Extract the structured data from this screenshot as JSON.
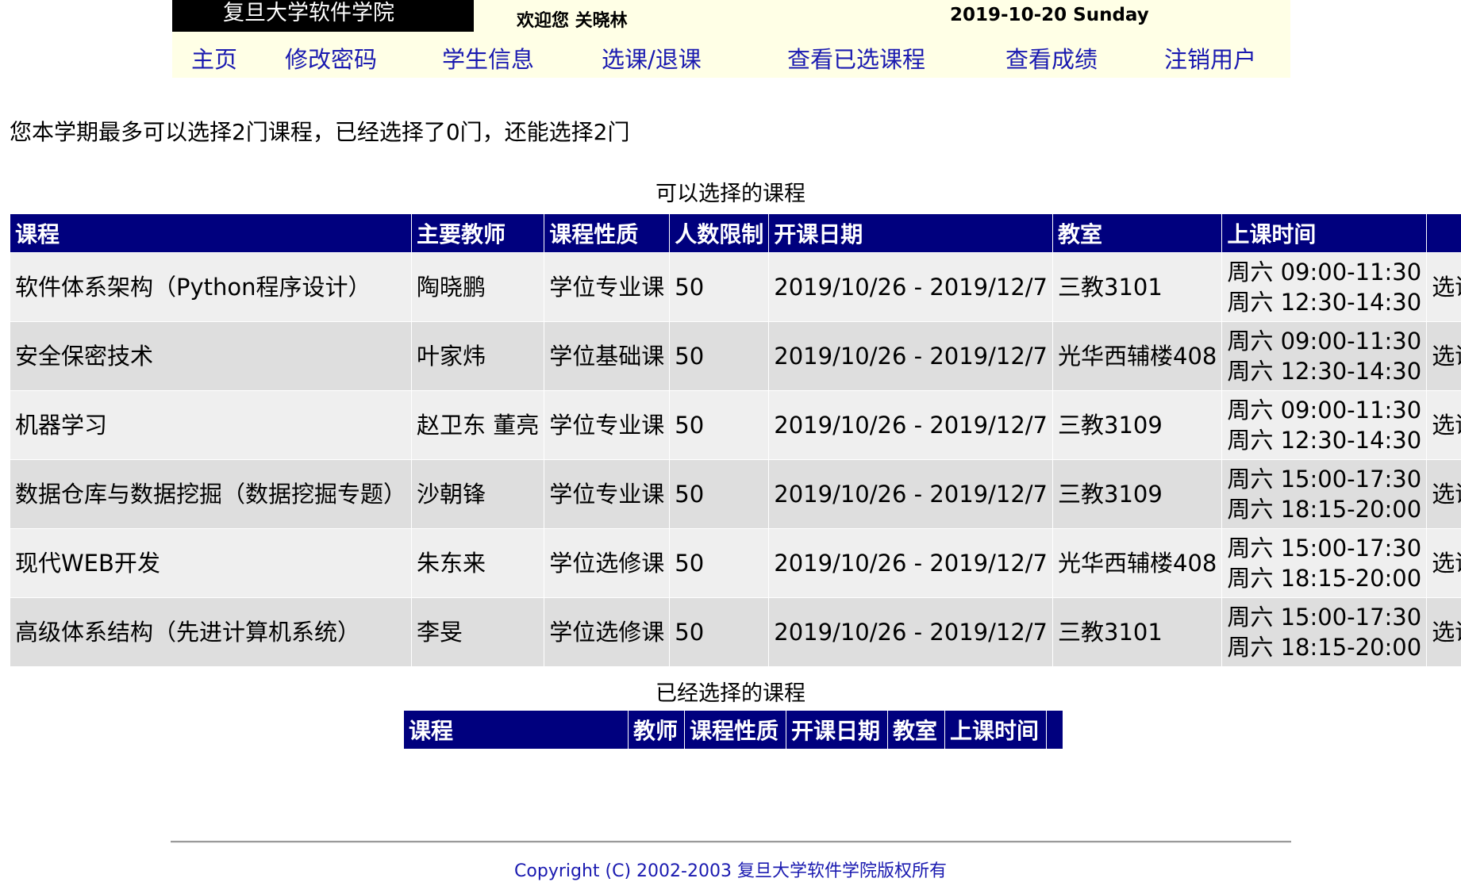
{
  "header": {
    "title": "复旦大学软件学院",
    "welcome": "欢迎您 关晓林",
    "date": "2019-10-20 Sunday",
    "nav": [
      "主页",
      "修改密码",
      "学生信息",
      "选课/退课",
      "查看已选课程",
      "查看成绩",
      "注销用户"
    ]
  },
  "limit_text": "您本学期最多可以选择2门课程，已经选择了0门，还能选择2门",
  "available": {
    "caption": "可以选择的课程",
    "columns": [
      "课程",
      "主要教师",
      "课程性质",
      "人数限制",
      "开课日期",
      "教室",
      "上课时间",
      ""
    ],
    "rows": [
      {
        "course": "软件体系架构（Python程序设计）",
        "teacher": "陶晓鹏",
        "type": "学位专业课",
        "limit": "50",
        "dates": "2019/10/26 - 2019/12/7",
        "room": "三教3101",
        "time1": "周六 09:00-11:30",
        "time2": "周六 12:30-14:30",
        "action": "选课"
      },
      {
        "course": "安全保密技术",
        "teacher": "叶家炜",
        "type": "学位基础课",
        "limit": "50",
        "dates": "2019/10/26 - 2019/12/7",
        "room": "光华西辅楼408",
        "time1": "周六 09:00-11:30",
        "time2": "周六 12:30-14:30",
        "action": "选课"
      },
      {
        "course": "机器学习",
        "teacher": "赵卫东 董亮",
        "type": "学位专业课",
        "limit": "50",
        "dates": "2019/10/26 - 2019/12/7",
        "room": "三教3109",
        "time1": "周六 09:00-11:30",
        "time2": "周六 12:30-14:30",
        "action": "选课"
      },
      {
        "course": "数据仓库与数据挖掘（数据挖掘专题）",
        "teacher": "沙朝锋",
        "type": "学位专业课",
        "limit": "50",
        "dates": "2019/10/26 - 2019/12/7",
        "room": "三教3109",
        "time1": "周六 15:00-17:30",
        "time2": "周六 18:15-20:00",
        "action": "选课"
      },
      {
        "course": "现代WEB开发",
        "teacher": "朱东来",
        "type": "学位选修课",
        "limit": "50",
        "dates": "2019/10/26 - 2019/12/7",
        "room": "光华西辅楼408",
        "time1": "周六 15:00-17:30",
        "time2": "周六 18:15-20:00",
        "action": "选课"
      },
      {
        "course": "高级体系结构（先进计算机系统）",
        "teacher": "李旻",
        "type": "学位选修课",
        "limit": "50",
        "dates": "2019/10/26 - 2019/12/7",
        "room": "三教3101",
        "time1": "周六 15:00-17:30",
        "time2": "周六 18:15-20:00",
        "action": "选课"
      }
    ]
  },
  "selected": {
    "caption": "已经选择的课程",
    "columns": [
      "课程",
      "教师",
      "课程性质",
      "开课日期",
      "教室",
      "上课时间",
      ""
    ]
  },
  "footer": {
    "copyright": "Copyright (C) 2002-2003 复旦大学软件学院版权所有"
  }
}
